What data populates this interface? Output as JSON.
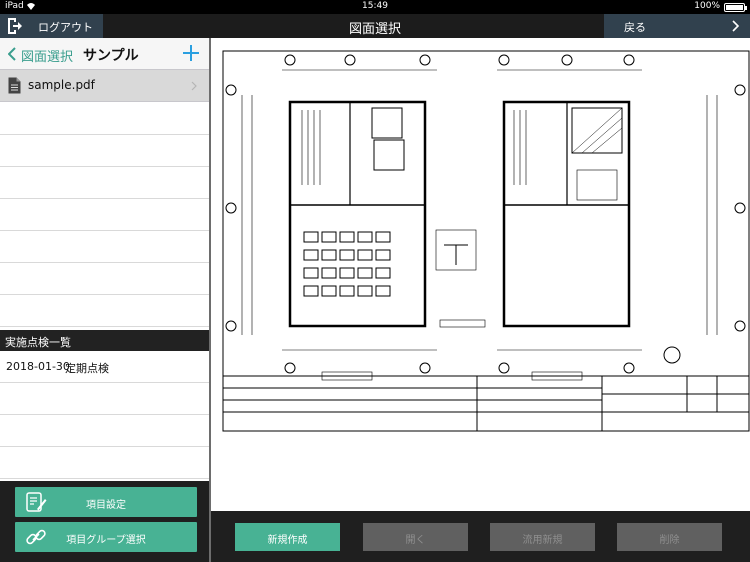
{
  "status_bar": {
    "carrier": "iPad",
    "time": "15:49",
    "battery_text": "100%",
    "battery_level": 1.0
  },
  "nav_bar": {
    "logout_label": "ログアウト",
    "title": "図面選択",
    "back_label": "戻る"
  },
  "left_panel": {
    "back_label": "図面選択",
    "folder_title": "サンプル",
    "files": [
      {
        "name": "sample.pdf"
      }
    ],
    "inspection_header": "実施点検一覧",
    "inspections": [
      {
        "date": "2018-01-30",
        "label": "定期点検"
      }
    ]
  },
  "left_buttons": {
    "item_settings": "項目設定",
    "item_group_select": "項目グループ選択"
  },
  "actions": {
    "new": "新規作成",
    "open": "開く",
    "reuse_new": "流用新規",
    "delete": "削除"
  },
  "colors": {
    "accent": "#48b294",
    "nav_block": "#31414e",
    "link": "#3a9e8e"
  }
}
